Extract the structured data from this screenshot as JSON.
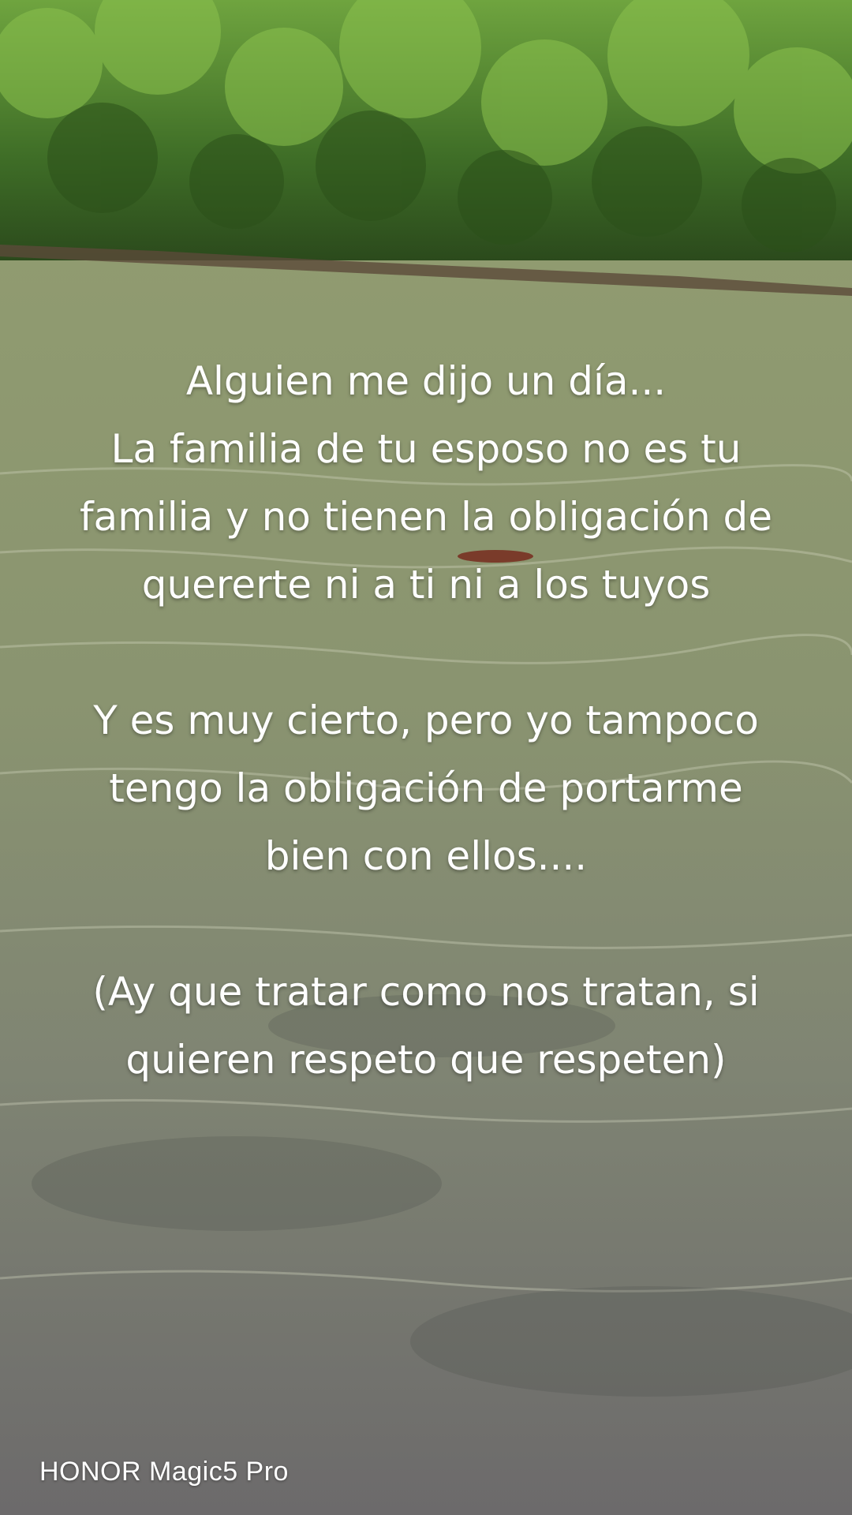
{
  "overlay": {
    "line1": "Alguien me dijo un día...",
    "line2": "La familia de tu esposo no es tu",
    "line3": "familia y no tienen la obligación de",
    "line4": "quererte ni a ti ni a los tuyos",
    "line5": "Y es muy cierto, pero yo tampoco",
    "line6": "tengo la obligación de portarme",
    "line7": "bien con ellos....",
    "line8": "(Ay que tratar como nos tratan, si",
    "line9": "quieren respeto que respeten)"
  },
  "watermark": {
    "text": "HONOR Magic5 Pro"
  },
  "colors": {
    "foliage_dark": "#2f5a1f",
    "foliage_light": "#7fb24a",
    "water_top": "#8d9a6c",
    "water_bottom": "#6f6a6a",
    "text": "#ffffff"
  }
}
